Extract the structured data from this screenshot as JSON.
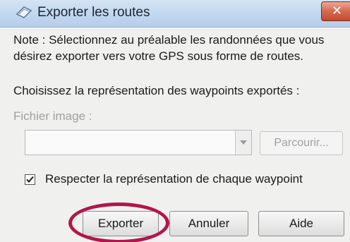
{
  "dialog": {
    "title": "Exporter les routes",
    "close_label": "✕",
    "note_line1": "Note : Sélectionnez au préalable les randonnées que vous",
    "note_line2": "désirez exporter vers votre GPS sous forme de routes.",
    "choose_label": "Choisissez la représentation des waypoints exportés :",
    "file_label": "Fichier image :",
    "file_value": "",
    "browse_label": "Parcourir...",
    "checkbox_label": "Respecter la représentation de chaque waypoint",
    "checkbox_checked": true,
    "buttons": {
      "export": "Exporter",
      "cancel": "Annuler",
      "help": "Aide"
    }
  },
  "colors": {
    "highlight": "#b2154c",
    "titlebar": "#c1d7ee",
    "close": "#c24a2e"
  },
  "icons": [
    "app-icon",
    "close-icon",
    "dropdown-arrow-icon",
    "checkmark-icon"
  ]
}
